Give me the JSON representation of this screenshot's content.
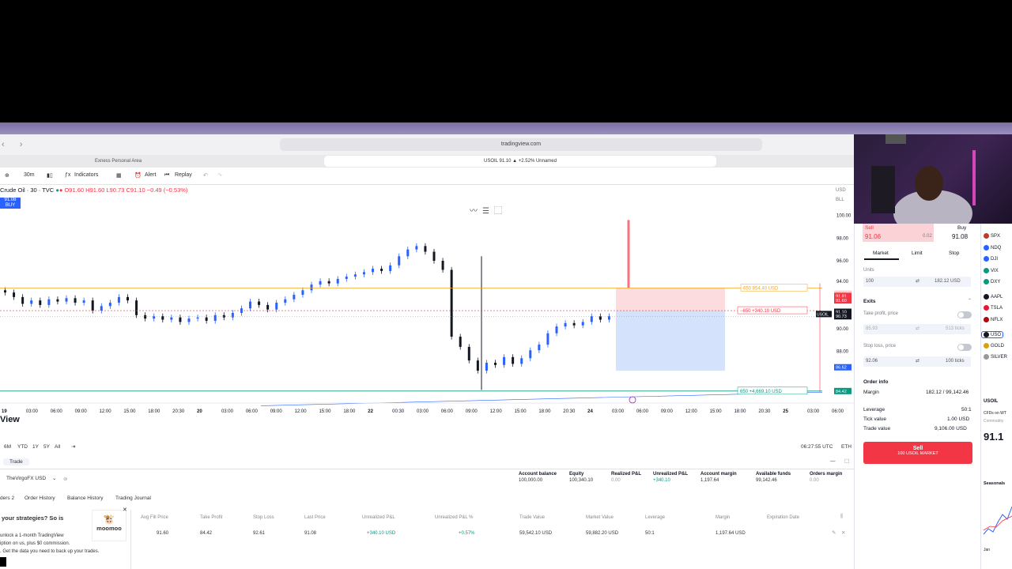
{
  "browser": {
    "url": "tradingview.com",
    "tab_left": "Exness Personal Area",
    "tab_main": "USOIL 91.10 ▲ +2.52% Unnamed"
  },
  "toolbar": {
    "interval": "30m",
    "indicators": "Indicators",
    "alert": "Alert",
    "replay": "Replay"
  },
  "legend": {
    "symbol": "Crude Oil · 30 · TVC",
    "ohlc": "O91.60 H91.60 L90.73 C91.10 −0.49 (−0.53%)",
    "buy_price": "91.08",
    "buy_label": "BUY"
  },
  "chart_data": {
    "type": "line",
    "title": "Crude Oil · 30 · TVC",
    "currency_labels": [
      "USD",
      "BLL"
    ],
    "ylim": [
      84,
      102
    ],
    "y_ticks": [
      "100.00",
      "98.00",
      "96.00",
      "94.00",
      "90.00",
      "88.00",
      "86.62",
      "84.42"
    ],
    "x_ticks": [
      "19",
      "03:00",
      "06:00",
      "09:00",
      "12:00",
      "15:00",
      "18:00",
      "20:30",
      "20",
      "03:00",
      "06:00",
      "09:00",
      "12:00",
      "15:00",
      "18:00",
      "22",
      "00:30",
      "03:00",
      "06:00",
      "09:00",
      "12:00",
      "15:00",
      "18:00",
      "20:30",
      "24",
      "03:00",
      "06:00",
      "09:00",
      "12:00",
      "15:00",
      "18:00",
      "20:30",
      "25",
      "03:00",
      "06:00"
    ],
    "series": [
      {
        "values": [
          93.2,
          92.8,
          92.2,
          92.5,
          92.1,
          92.6,
          92.4,
          92.7,
          92.3,
          92.5,
          91.6,
          92.0,
          92.3,
          92.8,
          92.5,
          91.2,
          90.9,
          91.1,
          90.8,
          91.0,
          90.6,
          90.9,
          91.0,
          90.7,
          91.2,
          91.0,
          91.4,
          91.8,
          92.4,
          92.1,
          91.7,
          92.3,
          92.6,
          93.0,
          93.4,
          93.9,
          94.2,
          94.0,
          94.4,
          94.6,
          94.8,
          95.0,
          95.3,
          95.1,
          95.6,
          96.4,
          97.0,
          97.3,
          96.8,
          96.0,
          95.2,
          89.3,
          88.4,
          87.2,
          86.3,
          87.0,
          86.8,
          87.5,
          86.9,
          87.4,
          88.1,
          88.6,
          89.6,
          90.2,
          90.5,
          90.3,
          90.6,
          91.1,
          90.8,
          91.1
        ]
      }
    ],
    "position_lines": {
      "entry_label": "−650",
      "entry_value": "+340.10 USD",
      "tp_label": "650",
      "tp_value": "+4,669.10 USD",
      "sl_label": "650",
      "sl_value": "854.40 USD"
    },
    "price_tags": [
      "92.61",
      "91.81",
      "91.60",
      "91.10",
      "90.73",
      "88.00",
      "86.62",
      "84.42"
    ],
    "symbol_tag": "USOIL"
  },
  "timeframes": [
    "6M",
    "YTD",
    "1Y",
    "5Y",
    "All"
  ],
  "clock": "06:27:55 UTC",
  "session": "ETH",
  "watermark": "View",
  "panel": {
    "title": "Trade",
    "account": "TheVirgoFX USD",
    "tabs": [
      "ders 2",
      "Order History",
      "Balance History",
      "Trading Journal"
    ],
    "summary": [
      {
        "label": "Account balance",
        "value": "100,000.00"
      },
      {
        "label": "Equity",
        "value": "100,340.10"
      },
      {
        "label": "Realized P&L",
        "value": "0.00"
      },
      {
        "label": "Unrealized P&L",
        "value": "+340.10"
      },
      {
        "label": "Account margin",
        "value": "1,197.64"
      },
      {
        "label": "Available funds",
        "value": "99,142.46"
      },
      {
        "label": "Orders margin",
        "value": "0.00"
      }
    ],
    "columns": [
      "Avg Fill Price",
      "Take Profit",
      "Stop Loss",
      "Last Price",
      "Unrealized P&L",
      "Unrealized P&L %",
      "Trade Value",
      "Market Value",
      "Leverage",
      "Margin",
      "Expiration Date"
    ],
    "row": [
      "91.60",
      "84.42",
      "92.61",
      "91.08",
      "+340.10 USD",
      "+0.57%",
      "59,542.10 USD",
      "59,882.20 USD",
      "50:1",
      "1,197.64 USD",
      ""
    ]
  },
  "ad": {
    "headline": "your strategies? So is",
    "brand": "moomoo",
    "line1": "unlock a 1-month TradingView",
    "line2": "iption on us, plus $0 commission.",
    "line3": ". Get the data you need to back up your trades."
  },
  "order_panel": {
    "sell_label": "Sell",
    "sell_price": "91.06",
    "spread": "0.02",
    "buy_label": "Buy",
    "buy_price": "91.08",
    "tabs": [
      "Market",
      "Limit",
      "Stop"
    ],
    "units_label": "Units",
    "units_value": "100",
    "units_usd": "182.12 USD",
    "exits": "Exits",
    "tp_label": "Take profit, price",
    "tp_value": "85.93",
    "tp_ticks": "513 ticks",
    "sl_label": "Stop loss, price",
    "sl_value": "92.06",
    "sl_ticks": "100 ticks",
    "info_title": "Order info",
    "margin_label": "Margin",
    "margin_value": "182.12 / 99,142.46",
    "leverage_label": "Leverage",
    "leverage_value": "50:1",
    "tick_label": "Tick value",
    "tick_value": "1.00 USD",
    "trade_label": "Trade value",
    "trade_value": "9,106.00 USD",
    "sell_button": "Sell",
    "sell_button_sub": "100 USOIL MARKET"
  },
  "watchlist": {
    "indices": [
      "SPX",
      "NDQ",
      "DJI",
      "VIX",
      "DXY"
    ],
    "stocks": [
      "AAPL",
      "TSLA",
      "NFLX"
    ],
    "futures": [
      "USO",
      "GOLD",
      "SILVER"
    ],
    "detail_symbol": "USOIL",
    "detail_desc": "CFDs on WT",
    "detail_cat": "Commodity",
    "detail_price": "91.1",
    "seasonals": "Seasonals",
    "month": "Jan"
  },
  "colors": {
    "up": "#2962ff",
    "down": "#131722",
    "sell": "#f23645",
    "tp_zone": "#cfe0fb",
    "sl_zone": "#fbd3d6"
  }
}
